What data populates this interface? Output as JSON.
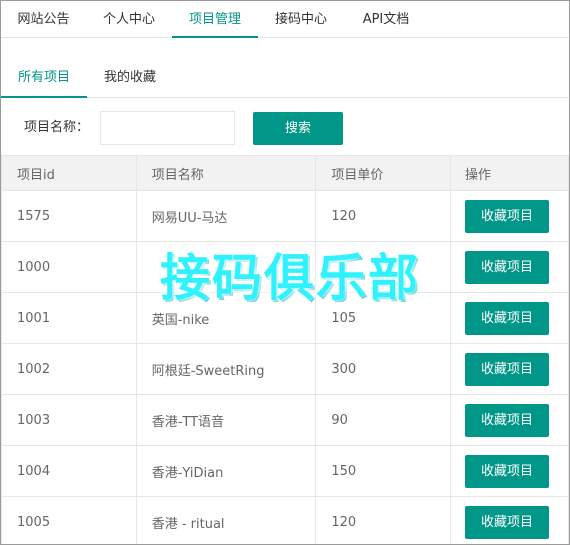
{
  "topnav": {
    "tabs": [
      {
        "label": "网站公告"
      },
      {
        "label": "个人中心"
      },
      {
        "label": "项目管理"
      },
      {
        "label": "接码中心"
      },
      {
        "label": "API文档"
      }
    ],
    "active_index": 2
  },
  "subnav": {
    "tabs": [
      {
        "label": "所有项目"
      },
      {
        "label": "我的收藏"
      }
    ],
    "active_index": 0
  },
  "search": {
    "label": "项目名称：",
    "value": "",
    "placeholder": "",
    "button_label": "搜索"
  },
  "table": {
    "headers": [
      "项目id",
      "项目名称",
      "项目单价",
      "操作"
    ],
    "rows": [
      {
        "id": "1575",
        "name": "网易UU-马达",
        "price": "120",
        "action": "收藏项目"
      },
      {
        "id": "1000",
        "name": "",
        "price": "",
        "action": "收藏项目"
      },
      {
        "id": "1001",
        "name": "英国-nike",
        "price": "105",
        "action": "收藏项目"
      },
      {
        "id": "1002",
        "name": "阿根廷-SweetRing",
        "price": "300",
        "action": "收藏项目"
      },
      {
        "id": "1003",
        "name": "香港-TT语音",
        "price": "90",
        "action": "收藏项目"
      },
      {
        "id": "1004",
        "name": "香港-YiDian",
        "price": "150",
        "action": "收藏项目"
      },
      {
        "id": "1005",
        "name": "香港 - ritual",
        "price": "120",
        "action": "收藏项目"
      }
    ]
  },
  "watermark": {
    "text": "接码俱乐部"
  },
  "colors": {
    "accent": "#009688",
    "border": "#e6e6e6",
    "header_bg": "#f2f2f2",
    "watermark": "#2ff2ff"
  }
}
